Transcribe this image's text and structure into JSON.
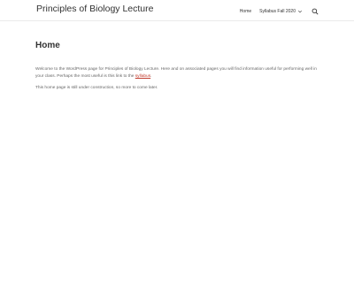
{
  "header": {
    "site_title": "Principles of Biology Lecture",
    "nav": [
      {
        "label": "Home"
      },
      {
        "label": "Syllabus Fall 2020"
      }
    ],
    "search_icon": "search-icon",
    "chevron_icon": "chevron-down-icon"
  },
  "main": {
    "title": "Home",
    "paragraph1_text": "Welcome to the WordPress page for Principles of Biology Lecture. Here and on associated pages you will find information useful for performing well in your class. Perhaps the most useful is this link to the ",
    "paragraph1_link": "syllabus",
    "paragraph1_end": ".",
    "paragraph2": "This home page is still under construction, so more to come later."
  },
  "colors": {
    "title_text": "#333333",
    "body_text": "#666666",
    "link": "#c0392b",
    "background": "#ffffff"
  }
}
